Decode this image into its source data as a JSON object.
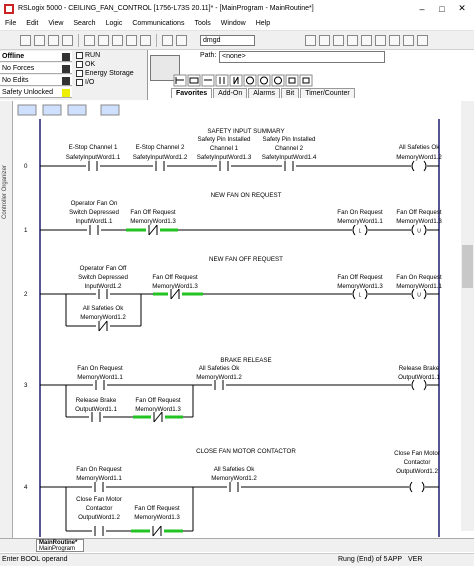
{
  "window": {
    "title": "RSLogix 5000 - CEILING_FAN_CONTROL [1756-L73S 20.11]* - [MainProgram - MainRoutine*]"
  },
  "menu": [
    "File",
    "Edit",
    "View",
    "Search",
    "Logic",
    "Communications",
    "Tools",
    "Window",
    "Help"
  ],
  "toolbar": {
    "dropdown_value": "dmgd"
  },
  "status_panel": {
    "mode": "Offline",
    "forces": "No Forces",
    "edits": "No Edits",
    "safety": "Safety Unlocked",
    "checks": [
      "RUN",
      "OK",
      "Energy Storage",
      "I/O"
    ]
  },
  "path": {
    "label": "Path:",
    "value": "<none>"
  },
  "instruction_tabs": [
    "Favorites",
    "Add-On",
    "Alarms",
    "Bit",
    "Timer/Counter"
  ],
  "sidebar": {
    "label": "Controller Organizer"
  },
  "rungs": [
    {
      "number": "0",
      "comment": "SAFETY INPUT SUMMARY",
      "elements": [
        {
          "label": "E-Stop Channel 1",
          "tag": "SafetyInputWord1.1"
        },
        {
          "label": "E-Stop Channel 2",
          "tag": "SafetyInputWord1.2"
        },
        {
          "label": "Safety Pin Installed",
          "label2": "Channel 1",
          "tag": "SafetyInputWord1.3"
        },
        {
          "label": "Safety Pin Installed",
          "label2": "Channel 2",
          "tag": "SafetyInputWord1.4"
        },
        {
          "label": "All Safeties Ok",
          "tag": "MemoryWord1.2"
        }
      ]
    },
    {
      "number": "1",
      "comment": "NEW FAN ON REQUEST",
      "elements": [
        {
          "label": "Operator Fan On",
          "label2": "Switch Depressed",
          "tag": "InputWord1.1"
        },
        {
          "label": "Fan Off Request",
          "tag": "MemoryWord1.3"
        },
        {
          "label": "Fan On Request",
          "tag": "MemoryWord1.1"
        },
        {
          "label": "Fan Off Request",
          "tag": "MemoryWord1.3"
        }
      ]
    },
    {
      "number": "2",
      "comment": "NEW FAN OFF REQUEST",
      "elements": [
        {
          "label": "Operator Fan Off",
          "label2": "Switch Depressed",
          "tag": "InputWord1.2"
        },
        {
          "label": "Fan Off Request",
          "tag": "MemoryWord1.3"
        },
        {
          "label": "Fan Off Request",
          "tag": "MemoryWord1.3"
        },
        {
          "label": "Fan On Request",
          "tag": "MemoryWord1.1"
        },
        {
          "label": "All Safeties Ok",
          "tag": "MemoryWord1.2"
        }
      ]
    },
    {
      "number": "3",
      "comment": "BRAKE RELEASE",
      "elements": [
        {
          "label": "Fan On Request",
          "tag": "MemoryWord1.1"
        },
        {
          "label": "All Safeties Ok",
          "tag": "MemoryWord1.2"
        },
        {
          "label": "Release Brake",
          "tag": "OutputWord1.1"
        },
        {
          "label": "Release Brake",
          "tag": "OutputWord1.1"
        },
        {
          "label": "Fan Off Request",
          "tag": "MemoryWord1.3"
        }
      ]
    },
    {
      "number": "4",
      "comment": "CLOSE FAN MOTOR CONTACTOR",
      "elements": [
        {
          "label": "Fan On Request",
          "tag": "MemoryWord1.1"
        },
        {
          "label": "All Safeties Ok",
          "tag": "MemoryWord1.2"
        },
        {
          "label": "Close Fan Motor",
          "label2": "Contactor",
          "tag": "OutputWord1.2"
        },
        {
          "label": "Close Fan Motor",
          "label2": "Contactor",
          "tag": "OutputWord1.2"
        },
        {
          "label": "Fan Off Request",
          "tag": "MemoryWord1.3"
        }
      ]
    }
  ],
  "routine_tab": {
    "label": "MainRoutine*",
    "sub": "MainProgram"
  },
  "statusbar": {
    "message": "Enter BOOL operand",
    "rung": "Rung (End) of 5",
    "app": "APP",
    "ver": "VER"
  },
  "colors": {
    "highlight": "#22c322",
    "rail": "#1e1e6e"
  }
}
